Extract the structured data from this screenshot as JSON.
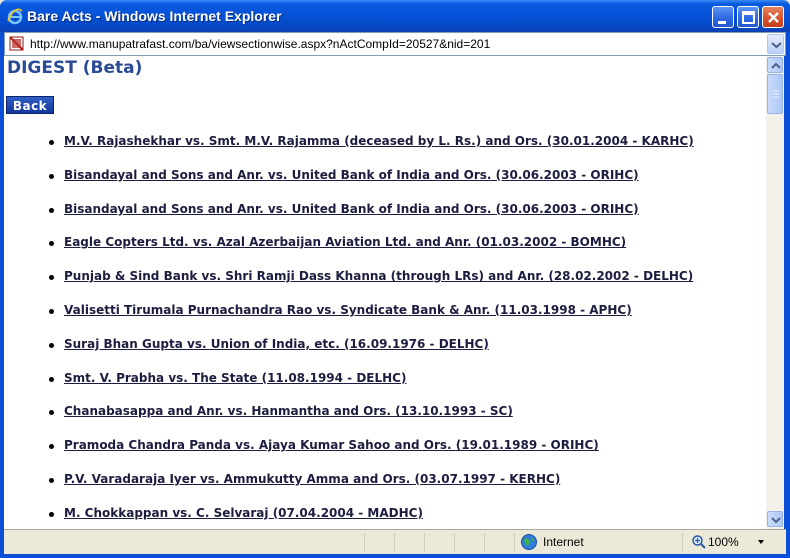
{
  "window": {
    "title": "Bare Acts - Windows Internet Explorer",
    "address": "http://www.manupatrafast.com/ba/viewsectionwise.aspx?nActCompId=20527&nid=201"
  },
  "page": {
    "heading": "DIGEST (Beta)",
    "back_label": "Back",
    "cases": [
      "M.V. Rajashekhar vs. Smt. M.V. Rajamma (deceased by L. Rs.) and Ors. (30.01.2004 - KARHC)",
      "Bisandayal and Sons and Anr. vs. United Bank of India and Ors. (30.06.2003 - ORIHC)",
      "Bisandayal and Sons and Anr. vs. United Bank of India and Ors. (30.06.2003 - ORIHC)",
      "Eagle Copters Ltd. vs. Azal Azerbaijan Aviation Ltd. and Anr. (01.03.2002 - BOMHC)",
      "Punjab & Sind Bank vs. Shri Ramji Dass Khanna (through LRs) and Anr. (28.02.2002 - DELHC)",
      "Valisetti Tirumala Purnachandra Rao vs. Syndicate Bank & Anr. (11.03.1998 - APHC)",
      "Suraj Bhan Gupta vs. Union of India, etc. (16.09.1976 - DELHC)",
      "Smt. V. Prabha vs. The State (11.08.1994 - DELHC)",
      "Chanabasappa and Anr. vs. Hanmantha and Ors. (13.10.1993 - SC)",
      "Pramoda Chandra Panda vs. Ajaya Kumar Sahoo and Ors. (19.01.1989 - ORIHC)",
      "P.V. Varadaraja Iyer vs. Ammukutty Amma and Ors. (03.07.1997 - KERHC)",
      "M. Chokkappan vs. C. Selvaraj (07.04.2004 - MADHC)"
    ]
  },
  "status": {
    "zone": "Internet",
    "zoom": "100%"
  },
  "colors": {
    "titlebar": "#0551d6",
    "heading": "#2a4a96",
    "back_button": "#16379a",
    "link": "#1d1d40"
  }
}
